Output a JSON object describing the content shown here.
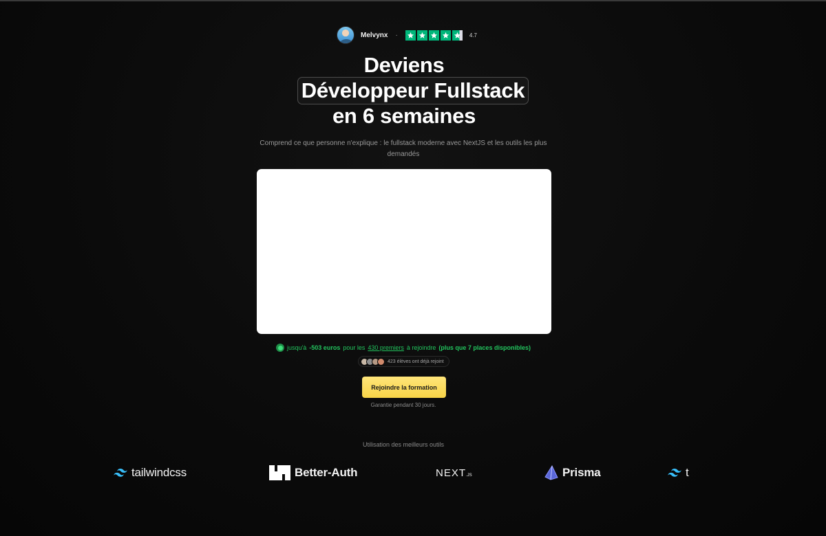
{
  "rating": {
    "author": "Melvynx",
    "separator": "·",
    "score": "4.7",
    "stars": 4.7,
    "star_color": "#00b67a"
  },
  "headline": {
    "line1": "Deviens",
    "highlight": "Développeur Fullstack",
    "line3": "en 6 semaines"
  },
  "subtitle": "Comprend ce que personne n'explique : le fullstack moderne avec NextJS et les outils les plus demandés",
  "offer": {
    "prefix": "jusqu'à",
    "discount": "-503 euros",
    "mid": "pour les",
    "link": "430 premiers",
    "suffix": "à rejoindre",
    "places": "(plus que 7 places disponibles)",
    "accent": "#22c55e"
  },
  "students": {
    "label": "423 élèves ont déjà rejoint"
  },
  "cta": {
    "label": "Rejoindre la formation",
    "color": "#f8d447"
  },
  "guarantee": "Garantie pendant 30 jours.",
  "tools": {
    "title": "Utilisation des meilleurs outils",
    "logos": [
      {
        "name": "tailwindcss",
        "icon": "tailwind-icon"
      },
      {
        "name": "Better-Auth",
        "icon": "better-auth-icon"
      },
      {
        "name": "NEXT",
        "suffix": ".JS",
        "icon": "nextjs-icon"
      },
      {
        "name": "Prisma",
        "icon": "prisma-icon"
      },
      {
        "name": "t",
        "icon": "tailwind-icon"
      }
    ]
  }
}
